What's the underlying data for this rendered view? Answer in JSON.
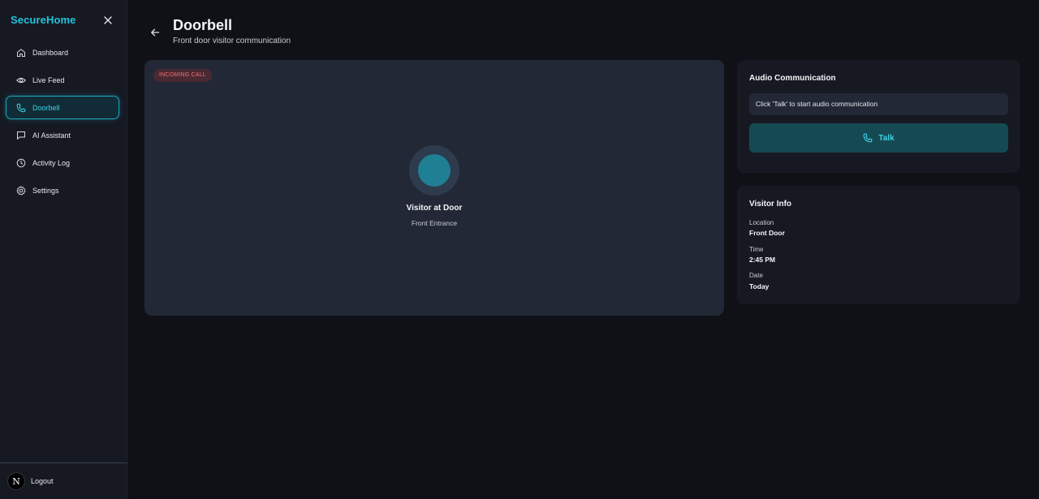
{
  "sidebar": {
    "brand": "SecureHome",
    "items": [
      {
        "label": "Dashboard",
        "icon": "home-icon"
      },
      {
        "label": "Live Feed",
        "icon": "eye-icon"
      },
      {
        "label": "Doorbell",
        "icon": "phone-icon",
        "active": true
      },
      {
        "label": "AI Assistant",
        "icon": "chat-icon"
      },
      {
        "label": "Activity Log",
        "icon": "clock-icon"
      },
      {
        "label": "Settings",
        "icon": "gear-icon"
      }
    ],
    "footer": {
      "avatar_letter": "N",
      "logout_label": "Logout"
    }
  },
  "header": {
    "title": "Doorbell",
    "subtitle": "Front door visitor communication"
  },
  "call_panel": {
    "badge": "INCOMING CALL",
    "visitor_title": "Visitor at Door",
    "visitor_location": "Front Entrance"
  },
  "audio_card": {
    "title": "Audio Communication",
    "status_text": "Click 'Talk' to start audio communication",
    "talk_label": "Talk"
  },
  "info_card": {
    "title": "Visitor Info",
    "fields": [
      {
        "label": "Location",
        "value": "Front Door"
      },
      {
        "label": "Time",
        "value": "2:45 PM"
      },
      {
        "label": "Date",
        "value": "Today"
      }
    ]
  },
  "colors": {
    "accent": "#22c3dc",
    "background": "#0f1117",
    "panel": "#232836",
    "card": "#161922",
    "badge_text": "#f0707a"
  }
}
